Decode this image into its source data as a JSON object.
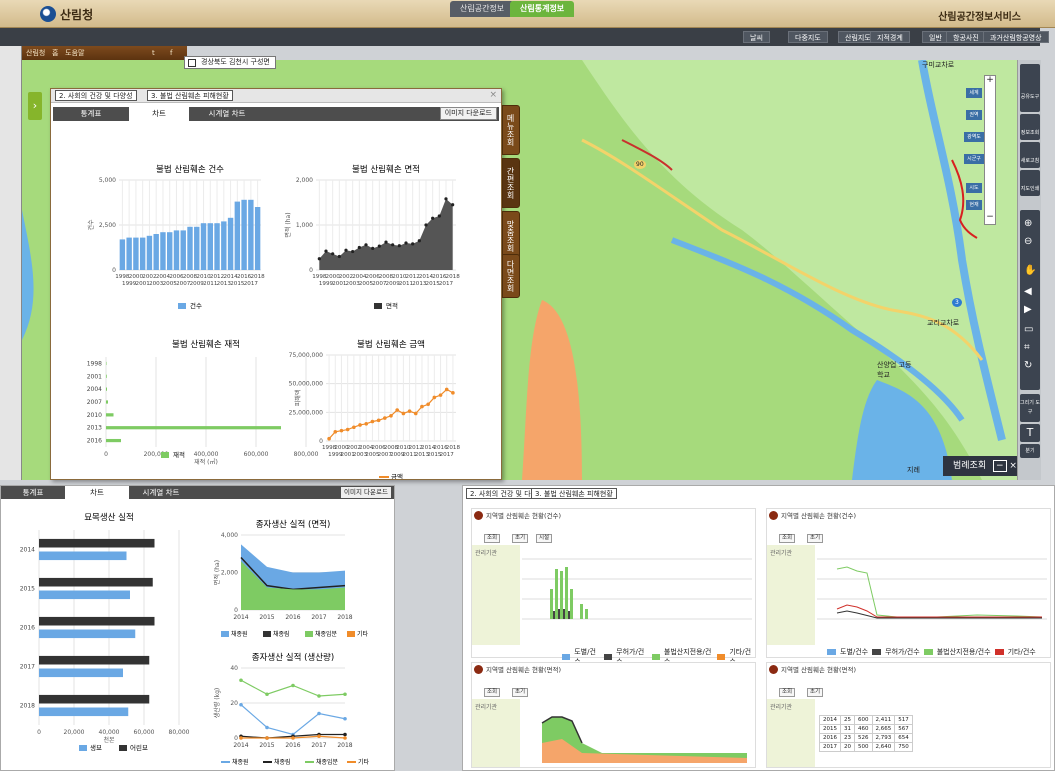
{
  "header": {
    "logo_text": "산림청",
    "service_title": "산림공간정보서비스"
  },
  "main_tabs": [
    "산림공간정보",
    "산림통계정보"
  ],
  "nav_buttons": [
    "날씨",
    "다중지도",
    "산림지도",
    "지적경계",
    "일반",
    "항공사진",
    "과거산림항공영상"
  ],
  "subbar": {
    "items": [
      "산림청",
      "홈",
      "도움말"
    ],
    "sns": [
      "t",
      "f"
    ]
  },
  "location": "경상북도 김천시 구성면",
  "map": {
    "labels": [
      "구미교차로",
      "90",
      "3",
      "교리교차로",
      "구미교차로",
      "산양업 고등학교",
      "지례"
    ],
    "scale_labels": [
      "세계",
      "권역",
      "광역도",
      "시군구",
      "시도",
      "현재"
    ],
    "zoom_plus": "+",
    "zoom_minus": "−"
  },
  "right_tools": [
    "공유도구",
    "정보조회",
    "새로고침",
    "지도인쇄",
    "",
    "",
    "",
    "",
    "",
    "",
    "",
    "",
    "그리기 도구",
    "T",
    "분기"
  ],
  "legend_panel": {
    "label": "범례조회",
    "min_icon": "−",
    "close_icon": "×"
  },
  "panel": {
    "select1": "2. 사회의 건강 및 다양성",
    "select2": "3. 불법 산림훼손 피해현황",
    "tabs": [
      "통계표",
      "차트",
      "시계열 차트"
    ],
    "image_download": "이미지 다운로드",
    "side_tabs": [
      "메뉴조회",
      "간편조회",
      "맞춤조회",
      "다면조회"
    ]
  },
  "chart_data": [
    {
      "type": "bar",
      "title": "불법 산림훼손 건수",
      "ylabel": "건수",
      "ylim": [
        0,
        5000
      ],
      "yticks": [
        "5,000",
        "2,500",
        "0"
      ],
      "categories": [
        "1998",
        "1999",
        "2000",
        "2001",
        "2002",
        "2003",
        "2004",
        "2005",
        "2006",
        "2007",
        "2008",
        "2009",
        "2010",
        "2011",
        "2012",
        "2013",
        "2014",
        "2015",
        "2016",
        "2017",
        "2018"
      ],
      "series": [
        {
          "name": "건수",
          "values": [
            1700,
            1800,
            1800,
            1800,
            1900,
            2000,
            2100,
            2100,
            2200,
            2200,
            2400,
            2400,
            2600,
            2600,
            2600,
            2700,
            2900,
            3800,
            3900,
            3900,
            3500
          ]
        }
      ]
    },
    {
      "type": "area",
      "title": "불법 산림훼손 면적",
      "ylabel": "면적 (ha)",
      "ylim": [
        0,
        2000
      ],
      "yticks": [
        "2,000",
        "1,000",
        "0"
      ],
      "categories": [
        "1998",
        "1999",
        "2000",
        "2001",
        "2002",
        "2003",
        "2004",
        "2005",
        "2006",
        "2007",
        "2008",
        "2009",
        "2010",
        "2011",
        "2012",
        "2013",
        "2014",
        "2015",
        "2016",
        "2017",
        "2018"
      ],
      "series": [
        {
          "name": "면적",
          "values": [
            250,
            420,
            360,
            300,
            440,
            410,
            500,
            560,
            480,
            530,
            620,
            560,
            540,
            600,
            580,
            650,
            1000,
            1150,
            1200,
            1580,
            1450
          ]
        }
      ]
    },
    {
      "type": "bar",
      "title": "불법 산림훼손 재적",
      "xlabel": "재적 (㎥)",
      "xticks": [
        "0",
        "200,000",
        "400,000",
        "600,000",
        "800,000"
      ],
      "categories": [
        "1998",
        "2001",
        "2004",
        "2007",
        "2010",
        "2013",
        "2016"
      ],
      "series": [
        {
          "name": "재적",
          "values": [
            2000,
            3000,
            4000,
            8000,
            30000,
            700000,
            60000
          ]
        }
      ]
    },
    {
      "type": "line",
      "title": "불법 산림훼손 금액",
      "ylabel": "피해액",
      "ylim": [
        0,
        75000000
      ],
      "yticks": [
        "75,000,000",
        "50,000,000",
        "25,000,000",
        "0"
      ],
      "categories": [
        "1998",
        "1999",
        "2000",
        "2001",
        "2002",
        "2003",
        "2004",
        "2005",
        "2006",
        "2007",
        "2008",
        "2009",
        "2010",
        "2011",
        "2012",
        "2013",
        "2014",
        "2015",
        "2016",
        "2017",
        "2018"
      ],
      "series": [
        {
          "name": "금액",
          "values": [
            2000000,
            8000000,
            9000000,
            10000000,
            12000000,
            14000000,
            15000000,
            17000000,
            18000000,
            20000000,
            22000000,
            27000000,
            24000000,
            26000000,
            24000000,
            30000000,
            32000000,
            38000000,
            40000000,
            45000000,
            42000000
          ]
        }
      ]
    },
    {
      "type": "bar",
      "title": "묘목생산 실적",
      "xlabel": "천본",
      "xticks": [
        "0",
        "20,000",
        "40,000",
        "60,000",
        "80,000"
      ],
      "categories": [
        "2014",
        "2015",
        "2016",
        "2017",
        "2018"
      ],
      "series": [
        {
          "name": "생묘",
          "values": [
            50000,
            52000,
            55000,
            48000,
            51000
          ]
        },
        {
          "name": "어린묘",
          "values": [
            66000,
            65000,
            66000,
            63000,
            63000
          ]
        }
      ]
    },
    {
      "type": "area",
      "title": "종자생산 실적 (면적)",
      "ylabel": "면적 (ha)",
      "ylim": [
        0,
        4000
      ],
      "yticks": [
        "4,000",
        "2,000",
        "0"
      ],
      "categories": [
        "2014",
        "2015",
        "2016",
        "2017",
        "2018"
      ],
      "series": [
        {
          "name": "채종원",
          "values": [
            3500,
            2300,
            2000,
            2000,
            2100
          ]
        },
        {
          "name": "채종림",
          "values": [
            2800,
            1300,
            1100,
            1200,
            1300
          ]
        },
        {
          "name": "채종임분",
          "values": [
            2600,
            1200,
            1100,
            1100,
            1200
          ]
        },
        {
          "name": "기타",
          "values": [
            0,
            0,
            0,
            0,
            0
          ]
        }
      ]
    },
    {
      "type": "line",
      "title": "종자생산 실적 (생산량)",
      "ylabel": "생산량 (kg)",
      "ylim": [
        0,
        40
      ],
      "yticks": [
        "40",
        "20",
        "0"
      ],
      "categories": [
        "2014",
        "2015",
        "2016",
        "2017",
        "2018"
      ],
      "series": [
        {
          "name": "채종원",
          "values": [
            19,
            6,
            2,
            14,
            11
          ]
        },
        {
          "name": "채종림",
          "values": [
            1,
            0,
            1,
            2,
            2
          ]
        },
        {
          "name": "채종임분",
          "values": [
            33,
            25,
            30,
            24,
            25
          ]
        },
        {
          "name": "기타",
          "values": [
            0,
            0,
            0,
            1,
            0
          ]
        }
      ]
    }
  ],
  "bottom_left": {
    "tabs": [
      "통계표",
      "차트",
      "시계열 차트"
    ],
    "image_download": "이미지 다운로드"
  },
  "bottom_right": {
    "select1": "2. 사회의 건강 및 다양성",
    "select2": "3. 불법 산림훼손 피해현황",
    "sub_titles": [
      "지역별 산림훼손 현황(건수)",
      "지역별 산림훼손 현황(건수)",
      "지역별 산림훼손 현황(면적)",
      "지역별 산림훼손 현황(면적)"
    ],
    "ctrl_labels": [
      "조회",
      "초기",
      "시설"
    ],
    "filter_label": "관리기관",
    "legends": [
      [
        "도별/건수",
        "무허가/건수",
        "불법산지전용/건수",
        "기타/건수"
      ],
      [
        "도별/건수",
        "무허가/건수",
        "불법산지전용/건수",
        "기타/건수"
      ]
    ],
    "table": {
      "rows": [
        [
          "2014",
          "25",
          "600",
          "2,411",
          "517"
        ],
        [
          "2015",
          "31",
          "460",
          "2,665",
          "567"
        ],
        [
          "2016",
          "23",
          "526",
          "2,793",
          "654"
        ],
        [
          "2017",
          "20",
          "500",
          "2,640",
          "750"
        ]
      ]
    }
  },
  "colors": {
    "bar_blue": "#6aa8e4",
    "area_dark": "#444444",
    "line_orange": "#f08c2a",
    "green": "#7ecb63",
    "panel_brown": "#7a4a1a"
  }
}
